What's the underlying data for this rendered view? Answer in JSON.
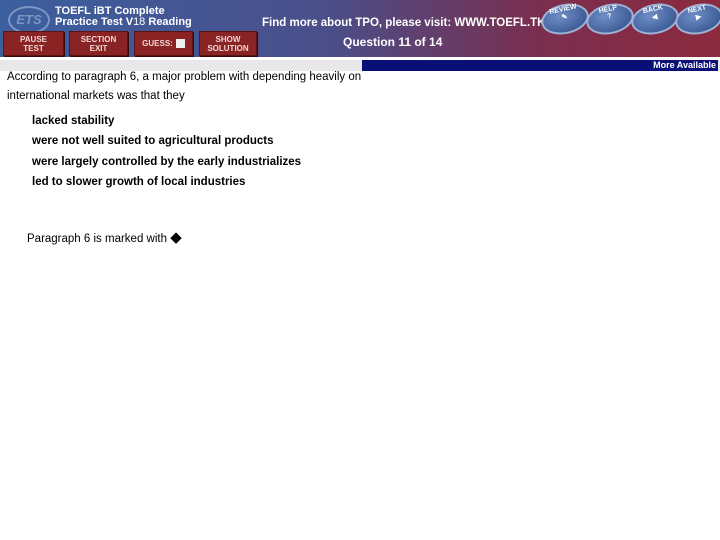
{
  "header": {
    "logo": "ETS",
    "title_line1": "TOEFL iBT Complete",
    "title_line2": "Practice Test V",
    "version": "18",
    "title_suffix": " Reading",
    "promo": "Find more about TPO, please visit:  WWW.TOEFL.TK",
    "question_counter": "Question 11 of 14"
  },
  "toolbar": {
    "pause": [
      "PAUSE",
      "TEST"
    ],
    "section_exit": [
      "SECTION",
      "EXIT"
    ],
    "guess": "GUESS:",
    "show_solution": [
      "SHOW",
      "SOLUTION"
    ]
  },
  "nav": {
    "review": "REVIEW",
    "help": "HELP",
    "back": "BACK",
    "next": "NEXT"
  },
  "status": {
    "more_available": "More Available"
  },
  "question": {
    "text": "According to paragraph 6, a major problem with depending heavily on international markets was that they",
    "options": [
      "lacked stability",
      "were not well suited to agricultural products",
      "were largely controlled by the early industrializes",
      "led to slower growth of local industries"
    ],
    "note": "Paragraph 6 is marked with"
  }
}
